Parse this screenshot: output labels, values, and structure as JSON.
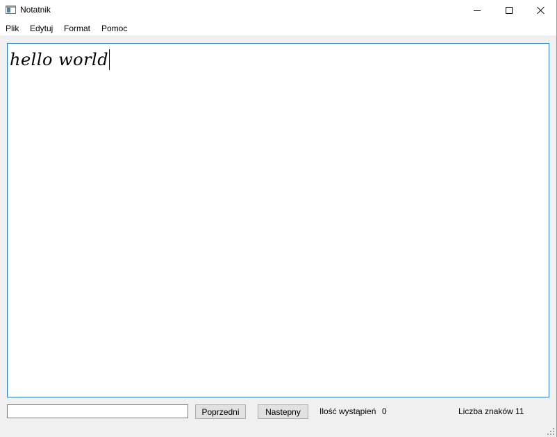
{
  "window": {
    "title": "Notatnik",
    "controls": {
      "minimize": "minimize",
      "maximize": "maximize",
      "close": "close"
    }
  },
  "menu": {
    "items": [
      "Plik",
      "Edytuj",
      "Format",
      "Pomoc"
    ]
  },
  "editor": {
    "content": "hello world"
  },
  "search": {
    "value": "",
    "placeholder": ""
  },
  "buttons": {
    "previous": "Poprzedni",
    "next": "Nastepny"
  },
  "status": {
    "occurrences_label": "Ilość wystąpień",
    "occurrences_value": "0",
    "char_count_label": "Liczba znaków 11"
  },
  "colors": {
    "editor_border": "#2d7fc9",
    "window_bg": "#f0f0f0",
    "button_bg": "#e1e1e1"
  }
}
